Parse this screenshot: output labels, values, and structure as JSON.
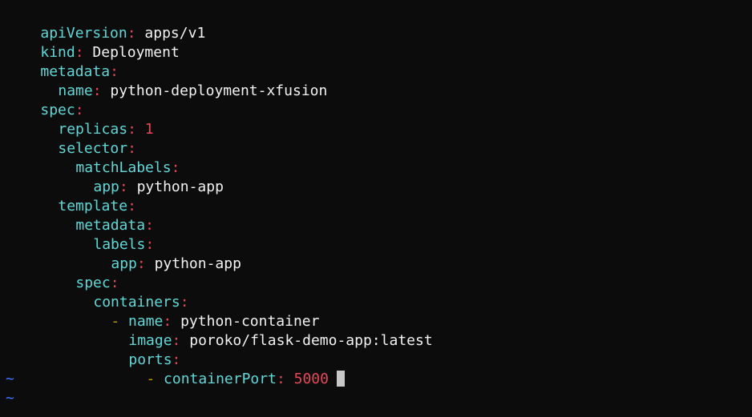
{
  "editor": {
    "colors": {
      "background": "#0c0c0c",
      "key": "#61d6d6",
      "punctuation": "#e74856",
      "dash": "#c19c00",
      "value": "#f2f2f2",
      "number": "#e74856",
      "tilde": "#3b78ff",
      "cursor": "#c8c8c8"
    },
    "lines": [
      {
        "key": "apiVersion",
        "sep": ":",
        "value": "apps/v1"
      },
      {
        "key": "kind",
        "sep": ":",
        "value": "Deployment"
      },
      {
        "key": "metadata",
        "sep": ":"
      },
      {
        "key": "name",
        "sep": ":",
        "value": "python-deployment-xfusion"
      },
      {
        "key": "spec",
        "sep": ":"
      },
      {
        "key": "replicas",
        "sep": ":",
        "value": "1"
      },
      {
        "key": "selector",
        "sep": ":"
      },
      {
        "key": "matchLabels",
        "sep": ":"
      },
      {
        "key": "app",
        "sep": ":",
        "value": "python-app"
      },
      {
        "key": "template",
        "sep": ":"
      },
      {
        "key": "metadata",
        "sep": ":"
      },
      {
        "key": "labels",
        "sep": ":"
      },
      {
        "key": "app",
        "sep": ":",
        "value": "python-app"
      },
      {
        "key": "spec",
        "sep": ":"
      },
      {
        "key": "containers",
        "sep": ":"
      },
      {
        "dash": "-",
        "key": "name",
        "sep": ":",
        "value": "python-container"
      },
      {
        "key": "image",
        "sep": ":",
        "value": "poroko/flask-demo-app:latest"
      },
      {
        "key": "ports",
        "sep": ":"
      },
      {
        "dash": "-",
        "key": "containerPort",
        "sep": ":",
        "value": "5000"
      }
    ],
    "tildes": [
      "~",
      "~"
    ]
  }
}
